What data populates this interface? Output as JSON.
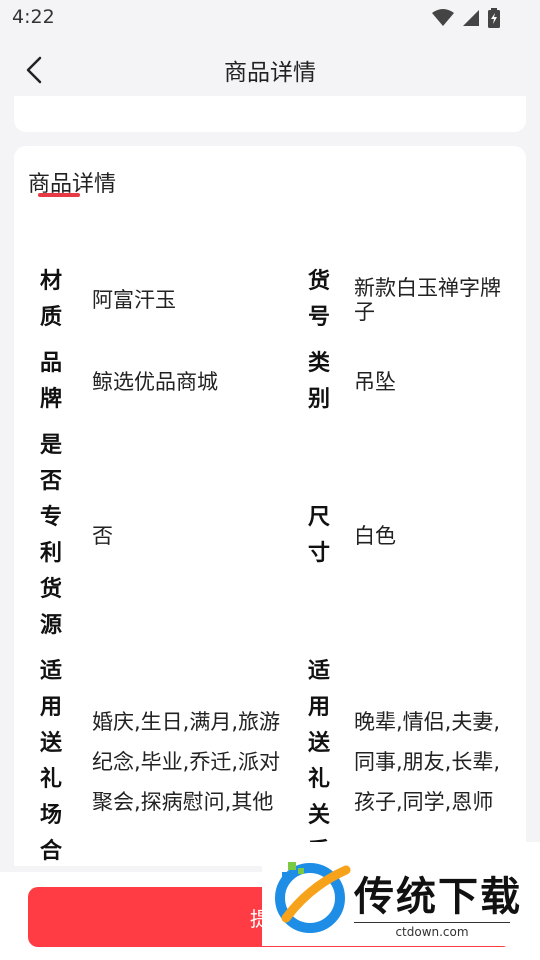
{
  "status_bar": {
    "time": "4:22"
  },
  "nav": {
    "title": "商品详情"
  },
  "detail": {
    "section_title": "商品详情",
    "rows": [
      {
        "l_label": "材\n质",
        "l_value": "阿富汗玉",
        "r_label": "货\n号",
        "r_value": "新款白玉禅字牌子"
      },
      {
        "l_label": "品\n牌",
        "l_value": "鲸选优品商城",
        "r_label": "类\n别",
        "r_value": "吊坠"
      },
      {
        "l_label": "是\n否\n专\n利\n货\n源",
        "l_value": "否",
        "r_label": "尺\n寸",
        "r_value": "白色"
      },
      {
        "l_label": "适\n用\n送\n礼\n场\n合",
        "l_value": "婚庆,生日,满月,旅游纪念,毕业,乔迁,派对聚会,探病慰问,其他",
        "r_label": "适\n用\n送\n礼\n关\n系",
        "r_value": "晚辈,情侣,夫妻,同事,朋友,长辈,孩子,同学,恩师"
      }
    ]
  },
  "bottom": {
    "submit_label": "提交"
  },
  "watermark": {
    "brand": "传统下载",
    "url": "ctdown.com"
  },
  "colors": {
    "accent": "#ff3b44",
    "underline": "#e83a44",
    "background": "#f4f4f6"
  }
}
